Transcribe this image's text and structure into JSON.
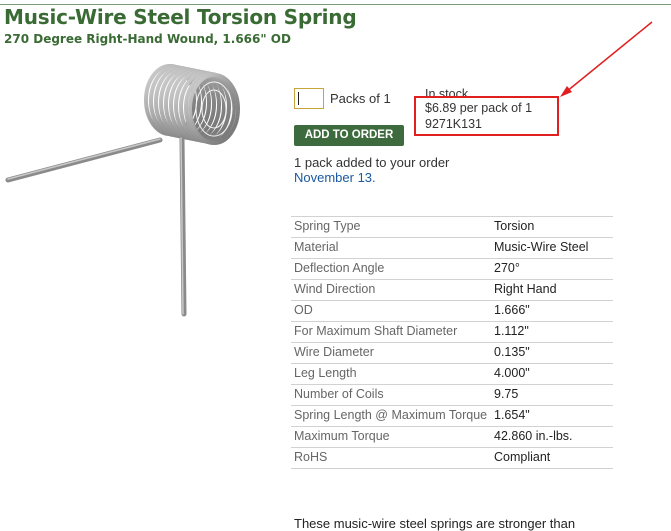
{
  "product": {
    "title": "Music-Wire Steel Torsion Spring",
    "subtitle": "270 Degree Right-Hand Wound, 1.666\" OD"
  },
  "order": {
    "quantity_value": "",
    "packs_label": "Packs of 1",
    "stock_status": "In stock",
    "price": "$6.89 per pack of 1",
    "part_number": "9271K131",
    "add_button_label": "ADD TO ORDER",
    "added_message": "1 pack added to your order",
    "added_date": "November 13."
  },
  "specs": [
    {
      "label": "Spring Type",
      "value": "Torsion"
    },
    {
      "label": "Material",
      "value": "Music-Wire Steel"
    },
    {
      "label": "Deflection Angle",
      "value": "270°"
    },
    {
      "label": "Wind Direction",
      "value": "Right Hand"
    },
    {
      "label": "OD",
      "value": "1.666\""
    },
    {
      "label": "For Maximum Shaft Diameter",
      "value": "1.112\""
    },
    {
      "label": "Wire Diameter",
      "value": "0.135\""
    },
    {
      "label": "Leg Length",
      "value": "4.000\""
    },
    {
      "label": "Number of Coils",
      "value": "9.75"
    },
    {
      "label": "Spring Length @ Maximum Torque",
      "value": "1.654\""
    },
    {
      "label": "Maximum Torque",
      "value": "42.860 in.-lbs."
    },
    {
      "label": "RoHS",
      "value": "Compliant"
    }
  ],
  "description_snippet": "These music-wire steel springs are stronger than",
  "colors": {
    "brand_green": "#3a6b35",
    "button_green": "#3d6b3d",
    "link_blue": "#1a5aa0",
    "annotation_red": "#e02020",
    "input_border": "#c9a43a"
  },
  "icons": {
    "product_image": "torsion-spring-image",
    "annotation": "red-arrow-annotation"
  }
}
